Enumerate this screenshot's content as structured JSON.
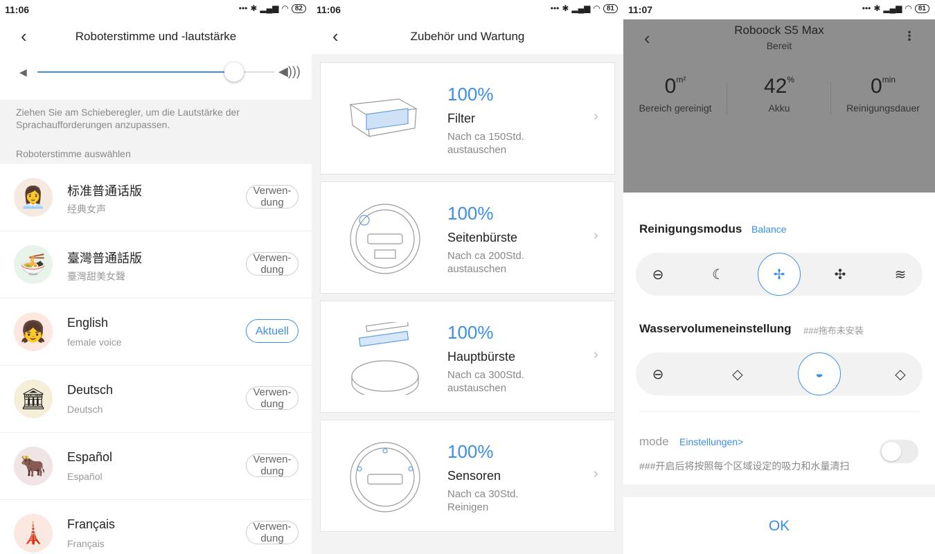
{
  "panel1": {
    "status": {
      "time": "11:06",
      "battery": "82"
    },
    "title": "Roboterstimme und -lautstärke",
    "volume_level": 0.83,
    "hint": "Ziehen Sie am Schieberegler, um die Lautstärke der Sprachaufforderungen anzupassen.",
    "section": "Roboterstimme auswählen",
    "voices": [
      {
        "name": "标准普通话版",
        "sub": "经典女声",
        "button": "Verwen-dung",
        "active": false,
        "icon": "woman-avatar-icon",
        "glyph": "👩‍💼"
      },
      {
        "name": "臺灣普通話版",
        "sub": "臺灣甜美女聲",
        "button": "Verwen-dung",
        "active": false,
        "icon": "noodle-bowl-icon",
        "glyph": "🍜"
      },
      {
        "name": "English",
        "sub": "female voice",
        "button": "Aktuell",
        "active": true,
        "icon": "girl-avatar-icon",
        "glyph": "👧"
      },
      {
        "name": "Deutsch",
        "sub": "Deutsch",
        "button": "Verwen-dung",
        "active": false,
        "icon": "brandenburg-gate-icon",
        "glyph": "🏛"
      },
      {
        "name": "Español",
        "sub": "Español",
        "button": "Verwen-dung",
        "active": false,
        "icon": "bull-icon",
        "glyph": "🐂"
      },
      {
        "name": "Français",
        "sub": "Français",
        "button": "Verwen-dung",
        "active": false,
        "icon": "eiffel-tower-icon",
        "glyph": "🗼"
      }
    ]
  },
  "panel2": {
    "status": {
      "time": "11:06",
      "battery": "81"
    },
    "title": "Zubehör und Wartung",
    "items": [
      {
        "percent": "100%",
        "name": "Filter",
        "note": "Nach ca 150Std. austauschen",
        "icon": "filter-icon"
      },
      {
        "percent": "100%",
        "name": "Seitenbürste",
        "note": "Nach ca 200Std. austauschen",
        "icon": "side-brush-robot-icon"
      },
      {
        "percent": "100%",
        "name": "Hauptbürste",
        "note": "Nach ca 300Std. austauschen",
        "icon": "main-brush-robot-icon"
      },
      {
        "percent": "100%",
        "name": "Sensoren",
        "note": "Nach ca 30Std. Reinigen",
        "icon": "sensor-robot-icon"
      }
    ]
  },
  "panel3": {
    "status": {
      "time": "11:07",
      "battery": "81"
    },
    "title": "Roboock S5 Max",
    "subtitle": "Bereit",
    "stats": [
      {
        "value": "0",
        "unit": "m²",
        "label": "Bereich gereinigt"
      },
      {
        "value": "42",
        "unit": "%",
        "label": "Akku"
      },
      {
        "value": "0",
        "unit": "min",
        "label": "Reinigungsdauer"
      }
    ],
    "clean_mode_label": "Reinigungsmodus",
    "clean_mode_value": "Balance",
    "water_label": "Wasservolumeneinstellung",
    "water_note": "###拖布未安装",
    "mode_label": "mode",
    "mode_link": "Einstellungen>",
    "mode_desc": "###开启后将按照每个区域设定的吸力和水量清扫",
    "ok": "OK"
  }
}
